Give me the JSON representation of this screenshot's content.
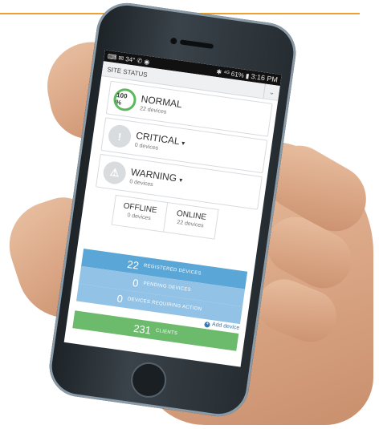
{
  "statusbar": {
    "left_icons": "⌨ ✉ 34° ✆ ◉",
    "right_icons": "✱ ⁴ᴳ 61% ▮",
    "time": "3:16 PM"
  },
  "header": {
    "title": "SITE STATUS",
    "chevron": "chevron-down-icon"
  },
  "cards": [
    {
      "badge": "100 %",
      "title": "NORMAL",
      "caret": "",
      "sub": "22 devices"
    },
    {
      "badge": "!",
      "title": "CRITICAL",
      "caret": "▾",
      "sub": "0 devices"
    },
    {
      "badge": "⚠",
      "title": "WARNING",
      "caret": "▾",
      "sub": "0 devices"
    }
  ],
  "split": [
    {
      "title": "OFFLINE",
      "sub": "0 devices"
    },
    {
      "title": "ONLINE",
      "sub": "22 devices"
    }
  ],
  "stats": [
    {
      "num": "22",
      "label": "REGISTERED DEVICES",
      "color": "#5aa6d6"
    },
    {
      "num": "0",
      "label": "PENDING DEVICES",
      "color": "#92c3e6"
    },
    {
      "num": "0",
      "label": "DEVICES REQUIRING ACTION",
      "color": "#92c3e6"
    }
  ],
  "add_device": "Add device",
  "clients": {
    "num": "231",
    "label": "CLIENTS",
    "color": "#6cbb6c"
  },
  "colors": {
    "accent_rule": "#f0a030",
    "normal_ring": "#5cb85c"
  }
}
